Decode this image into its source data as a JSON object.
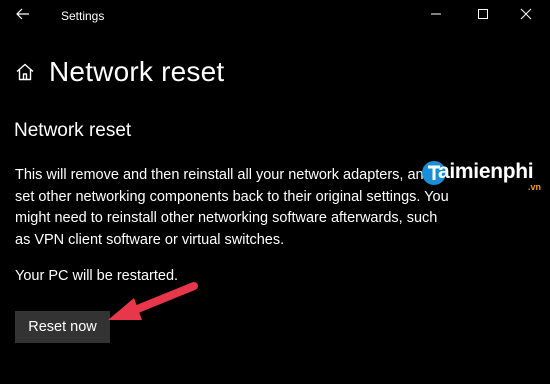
{
  "window": {
    "title": "Settings",
    "controls": [
      "minimize",
      "maximize",
      "close"
    ]
  },
  "icons": {
    "back": "back-arrow-icon",
    "home": "home-icon",
    "minimize": "minimize-icon",
    "maximize": "maximize-icon",
    "close": "close-icon",
    "annotation": "red-arrow"
  },
  "header": {
    "title": "Network reset"
  },
  "section": {
    "title": "Network reset",
    "description": "This will remove and then reinstall all your network adapters, and set other networking components back to their original settings. You might need to reinstall other networking software afterwards, such as VPN client software or virtual switches.",
    "restart_note": "Your PC will be restarted.",
    "reset_button_label": "Reset now"
  },
  "watermark": {
    "brand": "aimienphi",
    "suffix": ".vn"
  },
  "colors": {
    "background": "#000000",
    "text": "#ffffff",
    "button_bg": "#333333",
    "annotation_arrow": "#e8364a",
    "watermark_badge": "#1a8fd8",
    "watermark_suffix": "#f0a020"
  }
}
